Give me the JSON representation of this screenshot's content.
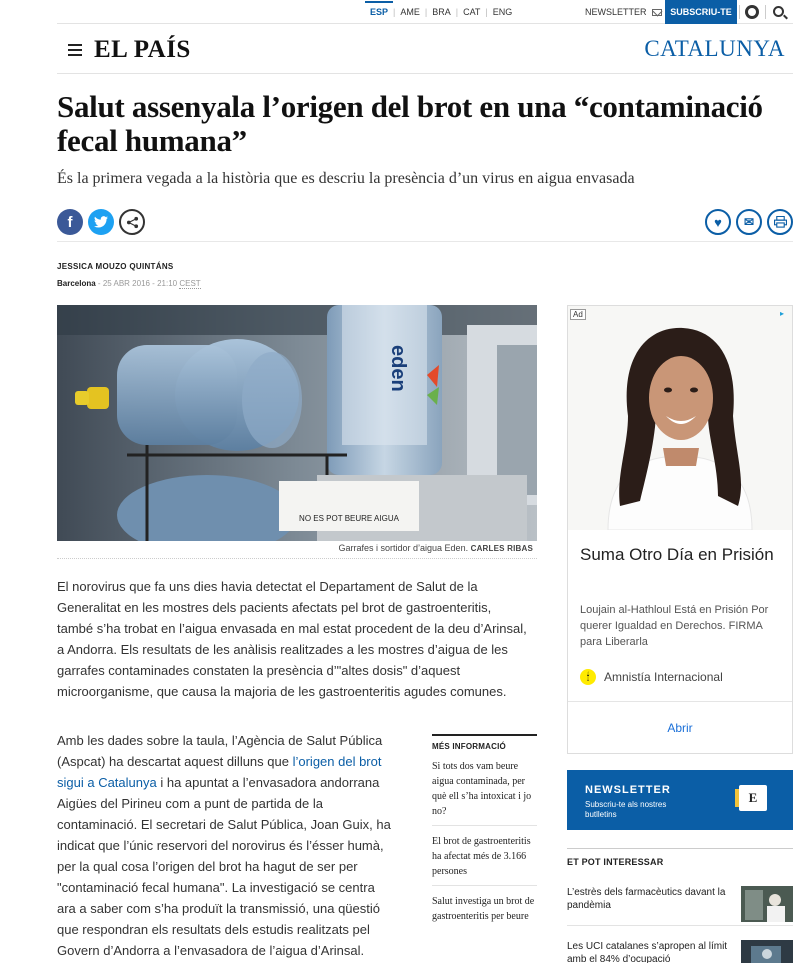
{
  "topbar": {
    "editions": [
      {
        "label": "ESP",
        "active": true
      },
      {
        "label": "AME",
        "active": false
      },
      {
        "label": "BRA",
        "active": false
      },
      {
        "label": "CAT",
        "active": false
      },
      {
        "label": "ENG",
        "active": false
      }
    ],
    "newsletter_label": "NEWSLETTER",
    "subscribe_label": "SUBSCRIU-TE"
  },
  "header": {
    "logo": "EL PAÍS",
    "section": "CATALUNYA"
  },
  "article": {
    "headline": "Salut assenyala l’origen del brot en una “contaminació fecal humana”",
    "subhead": "És la primera vegada a la història que es descriu la presència d’un virus en aigua envasada",
    "author": "JESSICA MOUZO QUINTÁNS",
    "location": "Barcelona",
    "date": "25 ABR 2016 - 21:10",
    "timezone": "CEST",
    "photo_sign": "NO ES POT BEURE AIGUA",
    "photo_bottle_brand": "eden",
    "caption": "Garrafes i sortidor d’aigua Eden.",
    "caption_credit": "CARLES RIBAS",
    "paragraph1": "El norovirus que fa uns dies havia detectat el Departament de Salut de la Generalitat en les mostres dels pacients afectats pel brot de gastroenteritis, també s’ha trobat en l’aigua envasada en mal estat procedent de la deu d’Arinsal, a Andorra. Els resultats de les anàlisis realitzades a les mostres d’aigua de les garrafes contaminades constaten la presència d’\"altes dosis\" d’aquest microorganisme, que causa la majoria de les gastroenteritis agudes comunes.",
    "paragraph2_before": "Amb les dades sobre la taula, l’Agència de Salut Pública (Aspcat) ha descartat aquest dilluns que ",
    "paragraph2_link": "l’origen del brot sigui a Catalunya",
    "paragraph2_after": " i ha apuntat a l’envasadora andorrana Aigües del Pirineu com a punt de partida de la contaminació. El secretari de Salut Pública, Joan Guix, ha indicat que l’únic reservori del norovirus és l’ésser humà, per la qual cosa l’origen del brot ha hagut de ser per \"contaminació fecal humana\". La investigació se centra ara a saber com s’ha produït la transmissió, una qüestió que respondran els resultats dels estudis realitzats pel Govern d’Andorra a l’envasadora de l’aigua d’Arinsal."
  },
  "more_info": {
    "title": "MÉS INFORMACIÓ",
    "items": [
      "Si tots dos vam beure aigua contaminada, per què ell s’ha intoxicat i jo no?",
      "El brot de gastroenteritis ha afectat més de 3.166 persones",
      "Salut investiga un brot de gastroenteritis per beure aigua"
    ]
  },
  "ad": {
    "label": "Ad",
    "title": "Suma Otro Día en Prisión",
    "text": "Loujain al-Hathloul Está en Prisión Por querer Igualdad en Derechos. FIRMA para Liberarla",
    "sponsor": "Amnistía Internacional",
    "cta": "Abrir"
  },
  "newsletter_promo": {
    "title": "NEWSLETTER",
    "text": "Subscriu-te als nostres butlletins",
    "icon_letter": "E"
  },
  "related": {
    "title": "ET POT INTERESSAR",
    "items": [
      "L’estrès dels farmacèutics davant la pandèmia",
      "Les UCI catalanes s’apropen al límit amb el 84% d’ocupació"
    ]
  },
  "colors": {
    "brand_blue": "#0b5ea6",
    "facebook": "#3b5998",
    "twitter": "#1da1f2"
  }
}
